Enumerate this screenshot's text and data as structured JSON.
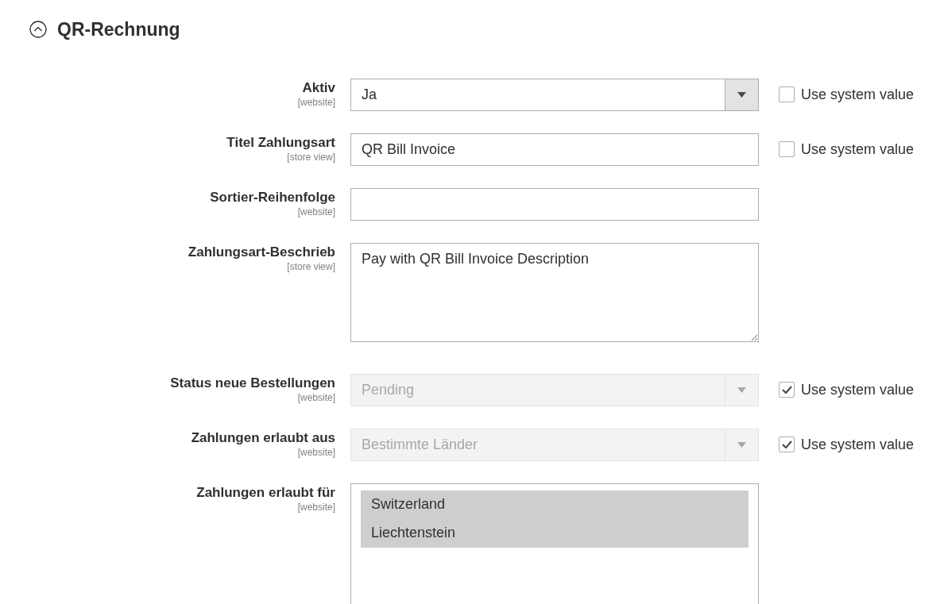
{
  "section": {
    "title": "QR-Rechnung",
    "expanded": true
  },
  "fields": [
    {
      "kind": "select",
      "label": "Aktiv",
      "scope": "[website]",
      "value": "Ja",
      "disabled": false,
      "use_system_value": {
        "label": "Use system value",
        "checked": false
      }
    },
    {
      "kind": "text",
      "label": "Titel Zahlungsart",
      "scope": "[store view]",
      "value": "QR Bill Invoice",
      "disabled": false,
      "use_system_value": {
        "label": "Use system value",
        "checked": false
      }
    },
    {
      "kind": "text",
      "label": "Sortier-Reihenfolge",
      "scope": "[website]",
      "disabled": false
    },
    {
      "kind": "textarea",
      "label": "Zahlungsart-Beschrieb",
      "scope": "[store view]",
      "value": "Pay with QR Bill Invoice Description",
      "disabled": false
    },
    {
      "kind": "select",
      "label": "Status neue Bestellungen",
      "scope": "[website]",
      "value": "Pending",
      "disabled": true,
      "use_system_value": {
        "label": "Use system value",
        "checked": true
      }
    },
    {
      "kind": "select",
      "label": "Zahlungen erlaubt aus",
      "scope": "[website]",
      "value": "Bestimmte Länder",
      "disabled": true,
      "use_system_value": {
        "label": "Use system value",
        "checked": true
      }
    },
    {
      "kind": "multiselect",
      "label": "Zahlungen erlaubt für",
      "scope": "[website]",
      "options": [
        {
          "label": "Switzerland",
          "selected": true
        },
        {
          "label": "Liechtenstein",
          "selected": true
        }
      ]
    }
  ]
}
